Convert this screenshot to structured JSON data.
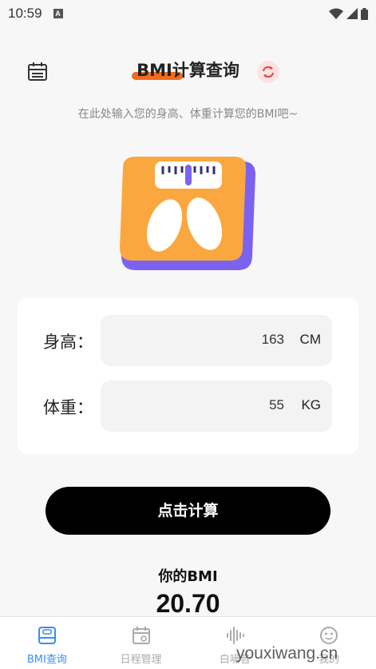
{
  "status_bar": {
    "time": "10:59",
    "notification_badge": "A"
  },
  "header": {
    "title": "BMI计算查询",
    "subtitle": "在此处输入您的身高、体重计算您的BMI吧~",
    "accent_color": "#f26b1d"
  },
  "form": {
    "height": {
      "label": "身高：",
      "value": "163",
      "unit": "CM"
    },
    "weight": {
      "label": "体重：",
      "value": "55",
      "unit": "KG"
    }
  },
  "calc_button": {
    "label": "点击计算"
  },
  "result": {
    "label": "你的BMI",
    "value": "20.70"
  },
  "tabs": [
    {
      "label": "BMI查询",
      "icon": "scale-icon",
      "active": true
    },
    {
      "label": "日程管理",
      "icon": "calendar-icon",
      "active": false
    },
    {
      "label": "白噪音",
      "icon": "soundwave-icon",
      "active": false
    },
    {
      "label": "我的",
      "icon": "face-icon",
      "active": false
    }
  ],
  "watermark": "youxiwang.cn",
  "colors": {
    "active_tab": "#3a8ef6",
    "scale_body": "#fba73f",
    "scale_base": "#7b63f0"
  }
}
